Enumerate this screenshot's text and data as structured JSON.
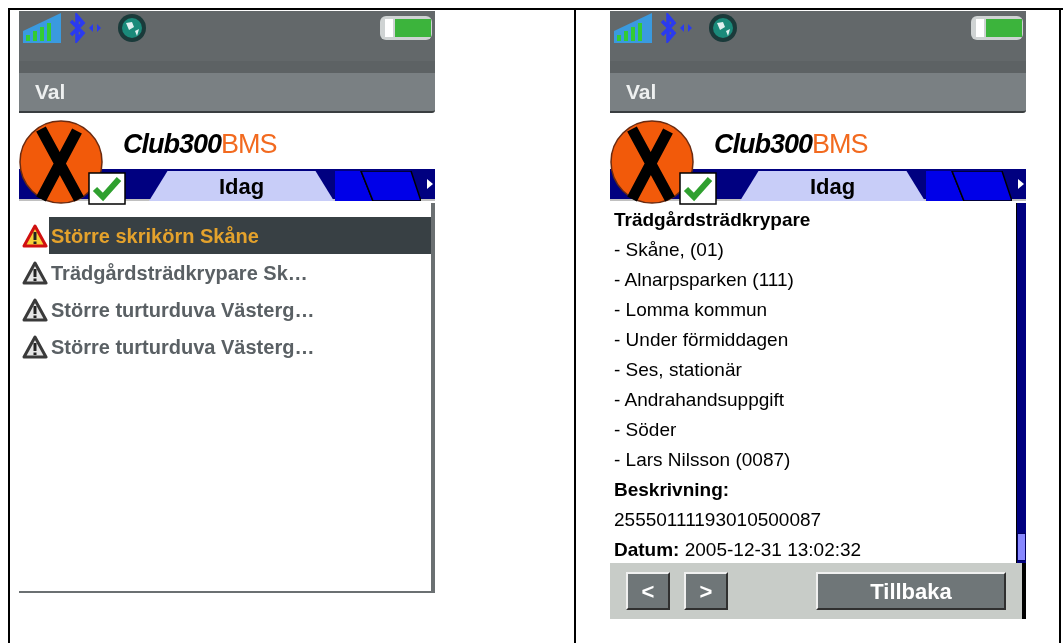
{
  "screens": [
    {
      "kind": "list",
      "menu": {
        "label": "Val"
      },
      "logo": {
        "text": "Club300",
        "suffix": "BMS"
      },
      "tabs": [
        {
          "label": "Idag",
          "selected": true
        }
      ],
      "list": [
        {
          "label": "Större skrikörn Skåne",
          "selected": true
        },
        {
          "label": "Trädgårdsträdkrypare Sk…",
          "selected": false
        },
        {
          "label": "Större turturduva Västerg…",
          "selected": false
        },
        {
          "label": "Större turturduva Västerg…",
          "selected": false
        }
      ]
    },
    {
      "kind": "detail",
      "menu": {
        "label": "Val"
      },
      "logo": {
        "text": "Club300",
        "suffix": "BMS"
      },
      "tabs": [
        {
          "label": "Idag",
          "selected": true
        }
      ],
      "detail": {
        "title": "Trädgårdsträdkrypare",
        "lines": [
          "- Skåne, (01)",
          "- Alnarpsparken (111)",
          "- Lomma kommun",
          "- Under förmiddagen",
          "- Ses, stationär",
          "- Andrahandsuppgift",
          "- Söder",
          "- Lars Nilsson (0087)"
        ],
        "description_label": "Beskrivning:",
        "description": "25550111193010500087",
        "date": "**Datum:** 2005-12-31 13:02:32"
      },
      "buttons": [
        {
          "label": "<"
        },
        {
          "label": ">"
        },
        {
          "label": "Tillbaka"
        }
      ]
    }
  ]
}
